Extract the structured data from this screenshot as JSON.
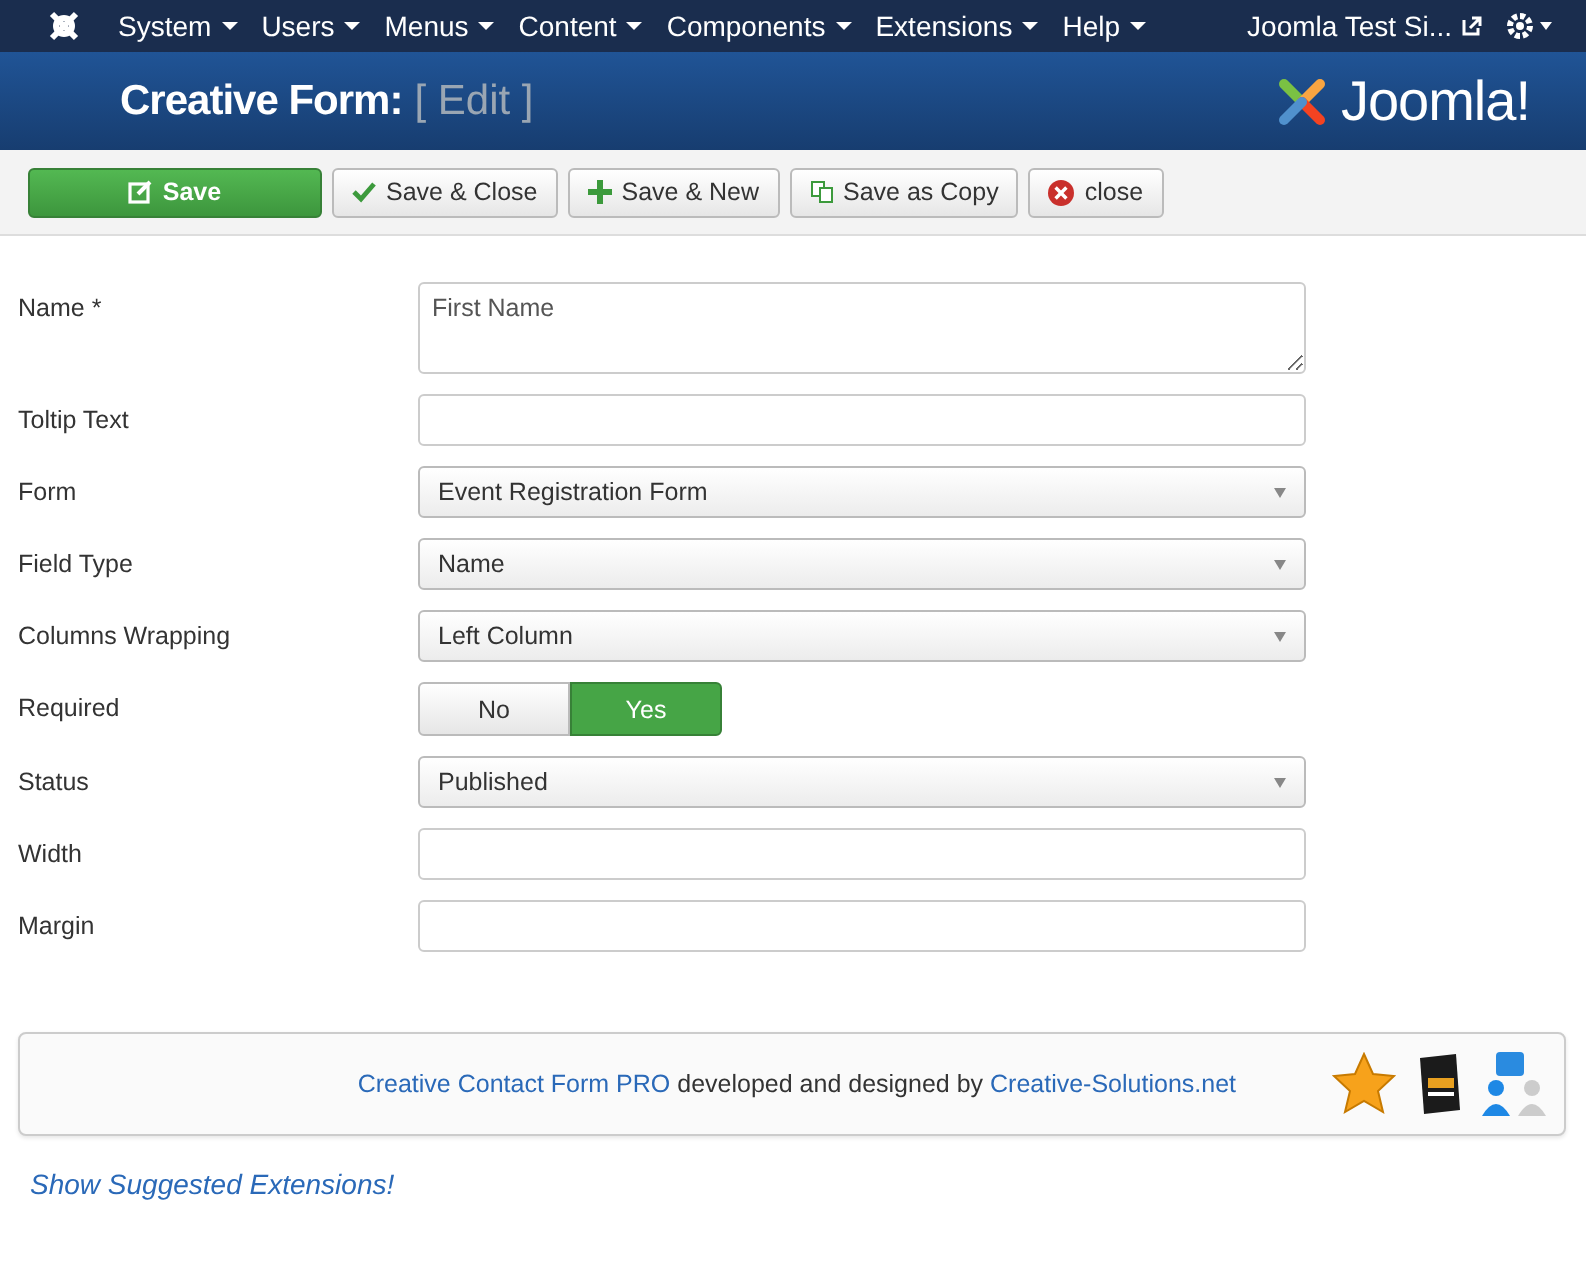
{
  "menu": {
    "items": [
      "System",
      "Users",
      "Menus",
      "Content",
      "Components",
      "Extensions",
      "Help"
    ],
    "site": "Joomla Test Si..."
  },
  "header": {
    "title": "Creative Form:",
    "subtitle": "[ Edit ]",
    "logo": "Joomla!"
  },
  "toolbar": [
    {
      "label": "Save",
      "kind": "save"
    },
    {
      "label": "Save & Close",
      "kind": "saveclose"
    },
    {
      "label": "Save & New",
      "kind": "savenew"
    },
    {
      "label": "Save as Copy",
      "kind": "savecopy"
    },
    {
      "label": "close",
      "kind": "close"
    }
  ],
  "fields": [
    {
      "label": "Name *",
      "kind": "textarea",
      "value": "First Name"
    },
    {
      "label": "Toltip Text",
      "kind": "text"
    },
    {
      "label": "Form",
      "kind": "select",
      "value": "Event Registration Form"
    },
    {
      "label": "Field Type",
      "kind": "select",
      "value": "Name"
    },
    {
      "label": "Columns Wrapping",
      "kind": "select",
      "value": "Left Column"
    },
    {
      "label": "Required",
      "kind": "toggle",
      "options": [
        {
          "label": "No",
          "selected": false
        },
        {
          "label": "Yes",
          "selected": true
        }
      ]
    },
    {
      "label": "Status",
      "kind": "select",
      "value": "Published"
    },
    {
      "label": "Width",
      "kind": "text"
    },
    {
      "label": "Margin",
      "kind": "text"
    }
  ],
  "footer": {
    "product_link": "Creative Contact Form PRO",
    "text": "developed and designed by",
    "company_link": "Creative-Solutions.net"
  },
  "suggested_link": "Show Suggested Extensions!"
}
